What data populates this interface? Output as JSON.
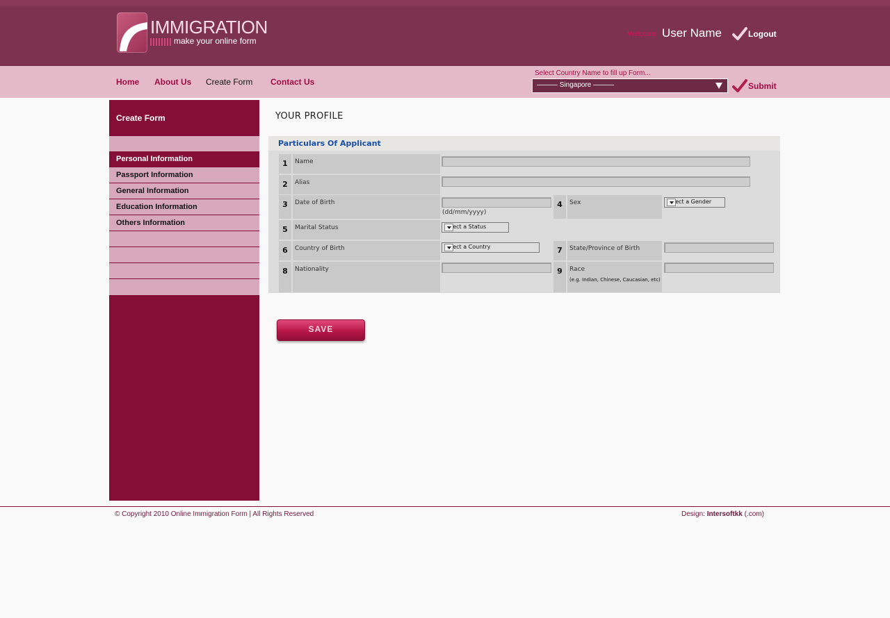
{
  "header": {
    "logo_title": "IMMIGRATION",
    "logo_tagline": "make your online form",
    "welcome": "Welcome",
    "user_name": "User Name",
    "logout_label": "Logout"
  },
  "nav": {
    "items": [
      {
        "label": "Home"
      },
      {
        "label": "About Us"
      },
      {
        "label": "Create Form"
      },
      {
        "label": "Contact Us"
      }
    ],
    "country_prompt": "Select Country Name to fill up Form...",
    "country_selected": "——— Singapore ———",
    "submit_label": "Submit"
  },
  "sidebar": {
    "heading": "Create Form",
    "items": [
      {
        "label": "Personal Information"
      },
      {
        "label": "Passport Information"
      },
      {
        "label": "General Information"
      },
      {
        "label": "Education Information"
      },
      {
        "label": "Others Information"
      }
    ]
  },
  "main": {
    "page_title": "YOUR PROFILE",
    "section_title": "Particulars Of Applicant",
    "fields": {
      "f1": {
        "num": "1",
        "label": "Name"
      },
      "f2": {
        "num": "2",
        "label": "Alias"
      },
      "f3": {
        "num": "3",
        "label": "Date of Birth",
        "hint": "(dd/mm/yyyy)"
      },
      "f4": {
        "num": "4",
        "label": "Sex",
        "select": "Select a Gender"
      },
      "f5": {
        "num": "5",
        "label": "Marital Status",
        "select": "Select a Status"
      },
      "f6": {
        "num": "6",
        "label": "Country of Birth",
        "select": "Select a Country"
      },
      "f7": {
        "num": "7",
        "label": "State/Province of Birth"
      },
      "f8": {
        "num": "8",
        "label": "Nationality"
      },
      "f9": {
        "num": "9",
        "label": "Race",
        "hint": "(e.g. Indian, Chinese, Caucasian, etc)"
      }
    },
    "save_label": "SAVE"
  },
  "footer": {
    "copyright": "© Copyright 2010 Online Immigration Form  |  All Rights Reserved",
    "design_prefix": "Design: ",
    "design_brand": "Intersoftkk",
    "design_suffix": " (.com)"
  },
  "colors": {
    "header_bg": "#7d3350",
    "nav_bg": "#e5bac8",
    "accent": "#850e36",
    "link": "#a00d43",
    "section_title": "#1a4fa6"
  }
}
